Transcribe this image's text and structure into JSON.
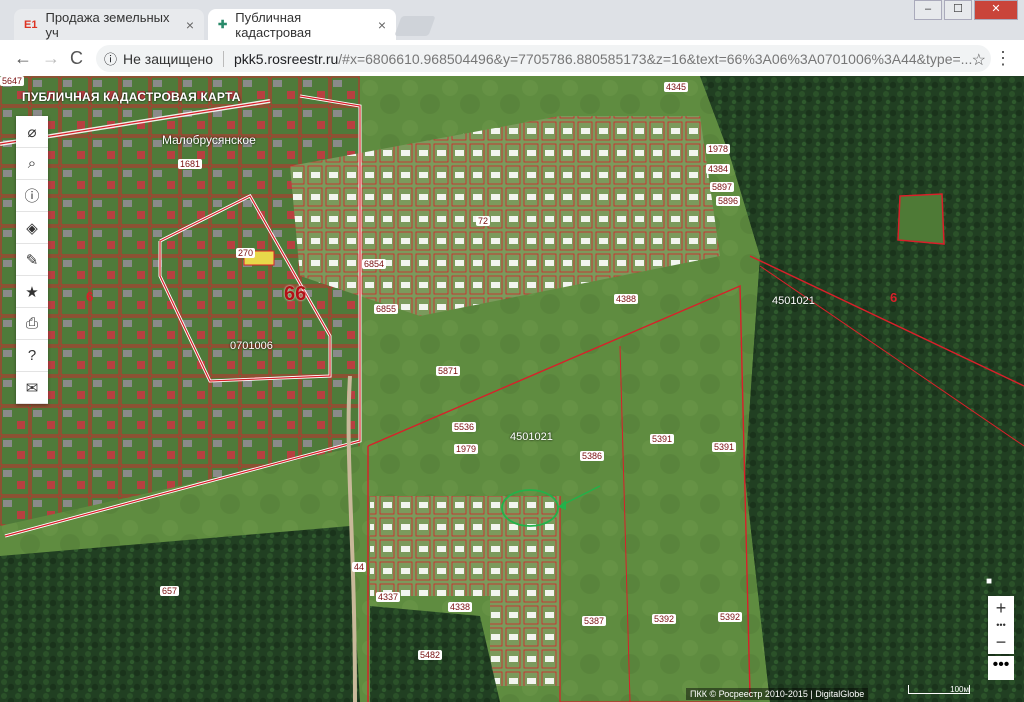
{
  "tabs": [
    {
      "favicon": "E1",
      "title": "Продажа земельных уч",
      "close": "×"
    },
    {
      "favicon": "✚",
      "title": "Публичная кадастровая",
      "close": "×"
    }
  ],
  "window": {
    "min": "–",
    "max": "☐",
    "close": "✕"
  },
  "toolbar": {
    "back": "←",
    "forward": "→",
    "reload": "C",
    "security": "Не защищено",
    "url_host": "pkk5.rosreestr.ru",
    "url_path": "/#x=6806610.968504496&y=7705786.880585173&z=16&text=66%3A06%3A0701006%3A44&type=...",
    "bookmark": "☆",
    "menu": "⋮"
  },
  "map": {
    "title": "ПУБЛИЧНАЯ КАДАСТРОВАЯ КАРТА",
    "village": "Малобрусянское",
    "region_label": "66",
    "labels": [
      {
        "t": "0701006",
        "c": "white"
      },
      {
        "t": "4501021",
        "c": "white"
      },
      {
        "t": "4501021",
        "c": "white"
      },
      {
        "t": "6",
        "c": "red"
      },
      {
        "t": "6",
        "c": "red"
      },
      {
        "t": "5871",
        "c": "white"
      },
      {
        "t": "6855",
        "c": "white"
      },
      {
        "t": "6854",
        "c": "white"
      },
      {
        "t": "4388",
        "c": "white"
      },
      {
        "t": "5386",
        "c": "white"
      },
      {
        "t": "5391",
        "c": "white"
      },
      {
        "t": "5391",
        "c": "white"
      },
      {
        "t": "5387",
        "c": "white"
      },
      {
        "t": "5392",
        "c": "white"
      },
      {
        "t": "5392",
        "c": "white"
      },
      {
        "t": "4338",
        "c": "white"
      },
      {
        "t": "4337",
        "c": "white"
      },
      {
        "t": "5482",
        "c": "white"
      },
      {
        "t": "657",
        "c": "white"
      },
      {
        "t": "5536",
        "c": "white"
      },
      {
        "t": "1979",
        "c": "white"
      },
      {
        "t": "1978",
        "c": "white"
      },
      {
        "t": "4384",
        "c": "white"
      },
      {
        "t": "5897",
        "c": "white"
      },
      {
        "t": "5896",
        "c": "white"
      },
      {
        "t": "4345",
        "c": "white"
      },
      {
        "t": "1681",
        "c": "white"
      },
      {
        "t": "270",
        "c": "white"
      },
      {
        "t": "44",
        "c": "white"
      },
      {
        "t": "72",
        "c": "white"
      },
      {
        "t": "5647",
        "c": "white"
      }
    ],
    "attribution": "ПКК © Росреестр 2010-2015 | DigitalGlobe",
    "scale": "100м"
  },
  "sidebar": [
    {
      "icon": "no-layers-icon",
      "glyph": "⌀"
    },
    {
      "icon": "search-icon",
      "glyph": "⌕"
    },
    {
      "icon": "info-icon",
      "glyph": "ⓘ"
    },
    {
      "icon": "layers-icon",
      "glyph": "◈"
    },
    {
      "icon": "pencil-icon",
      "glyph": "✎"
    },
    {
      "icon": "star-icon",
      "glyph": "★"
    },
    {
      "icon": "print-icon",
      "glyph": "⎙"
    },
    {
      "icon": "help-icon",
      "glyph": "?"
    },
    {
      "icon": "mail-icon",
      "glyph": "✉"
    }
  ],
  "zoom": {
    "plus": "+",
    "dots": "•••",
    "minus": "−",
    "more": "•••"
  },
  "colors": {
    "boundary": "#d8202a",
    "field": "#5d8a3e",
    "forest": "#1f3d22"
  }
}
